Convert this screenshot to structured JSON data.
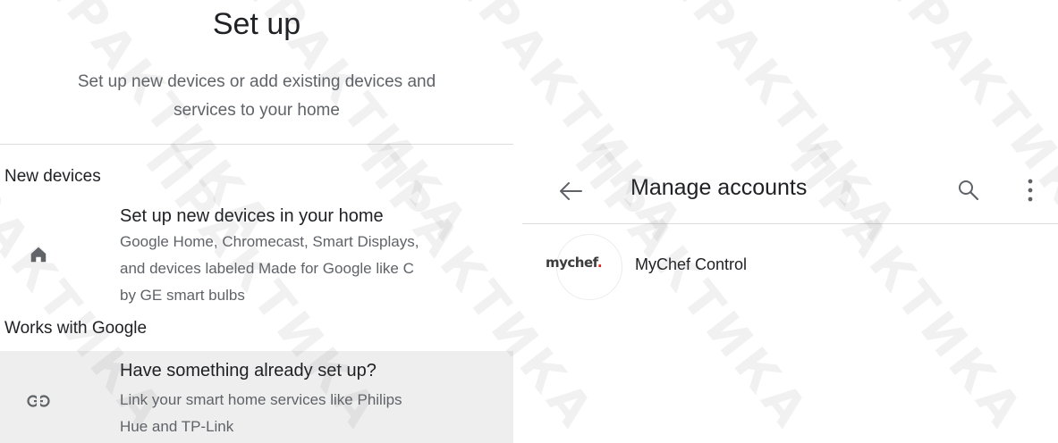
{
  "setup": {
    "title": "Set up",
    "subtitle_line1": "Set up new devices or add existing devices and",
    "subtitle_line2": "services to your home",
    "new_devices": {
      "heading": "New devices",
      "title": "Set up new devices in your home",
      "desc_line1": "Google Home, Chromecast, Smart Displays,",
      "desc_line2": "and devices labeled Made for Google like C",
      "desc_line3": "by GE smart bulbs",
      "icon": "home-icon"
    },
    "works_with_google": {
      "heading": "Works with Google",
      "title": "Have something already set up?",
      "desc_line1": "Link your smart home services like Philips",
      "desc_line2": "Hue and TP-Link",
      "icon": "link-icon"
    }
  },
  "manage_accounts": {
    "title": "Manage accounts",
    "back_icon": "arrow-back-icon",
    "search_icon": "search-icon",
    "more_icon": "more-vert-icon",
    "accounts": [
      {
        "logo_text": "mychef",
        "logo_dot": ".",
        "name": "MyChef Control"
      }
    ]
  },
  "colors": {
    "highlight_row": "#eeeeee",
    "logo_dot": "#e2231a",
    "secondary_text": "#5f6368",
    "divider": "#dadce0"
  }
}
